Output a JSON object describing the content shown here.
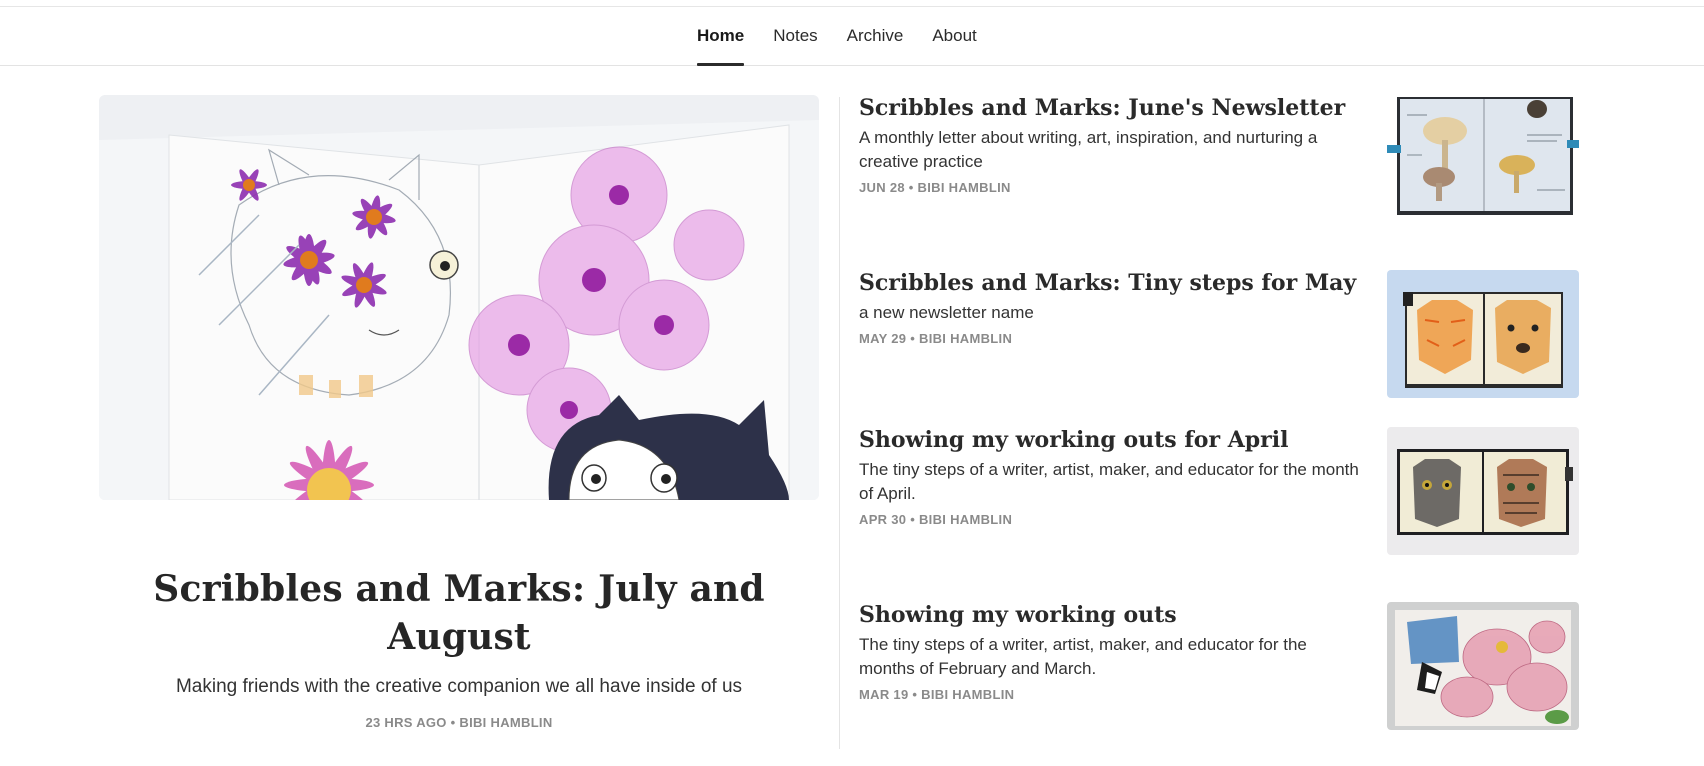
{
  "nav": {
    "items": [
      {
        "label": "Home",
        "active": true
      },
      {
        "label": "Notes",
        "active": false
      },
      {
        "label": "Archive",
        "active": false
      },
      {
        "label": "About",
        "active": false
      }
    ]
  },
  "featured": {
    "title": "Scribbles and Marks: July and August",
    "subtitle": "Making friends with the creative companion we all have inside of us",
    "meta": "23 HRS AGO • BIBI HAMBLIN",
    "image": "sketch of cats with pink poppies and purple daisies"
  },
  "posts": [
    {
      "title": "Scribbles and Marks: June's Newsletter",
      "subtitle": "A monthly letter about writing, art, inspiration, and nurturing a creative practice",
      "meta": "JUN 28 • BIBI HAMBLIN",
      "thumbnail": "sketchbook with mushroom drawings"
    },
    {
      "title": "Scribbles and Marks: Tiny steps for May",
      "subtitle": "a new newsletter name",
      "meta": "MAY 29 • BIBI HAMBLIN",
      "thumbnail": "sketchbook with orange cat and dog"
    },
    {
      "title": "Showing my working outs for April",
      "subtitle": "The tiny steps of a writer, artist, maker, and educator for the month of April.",
      "meta": "APR 30 • BIBI HAMBLIN",
      "thumbnail": "sketchbook with two cat portraits"
    },
    {
      "title": "Showing my working outs",
      "subtitle": "The tiny steps of a writer, artist, maker, and educator for the months of February and March.",
      "meta": "MAR 19 • BIBI HAMBLIN",
      "thumbnail": "cat with pink flowers painting"
    }
  ],
  "colors": {
    "text": "#262626",
    "meta": "#8a8a8a",
    "divider": "#e4e4e4",
    "nav_underline": "#2b2b2b"
  }
}
